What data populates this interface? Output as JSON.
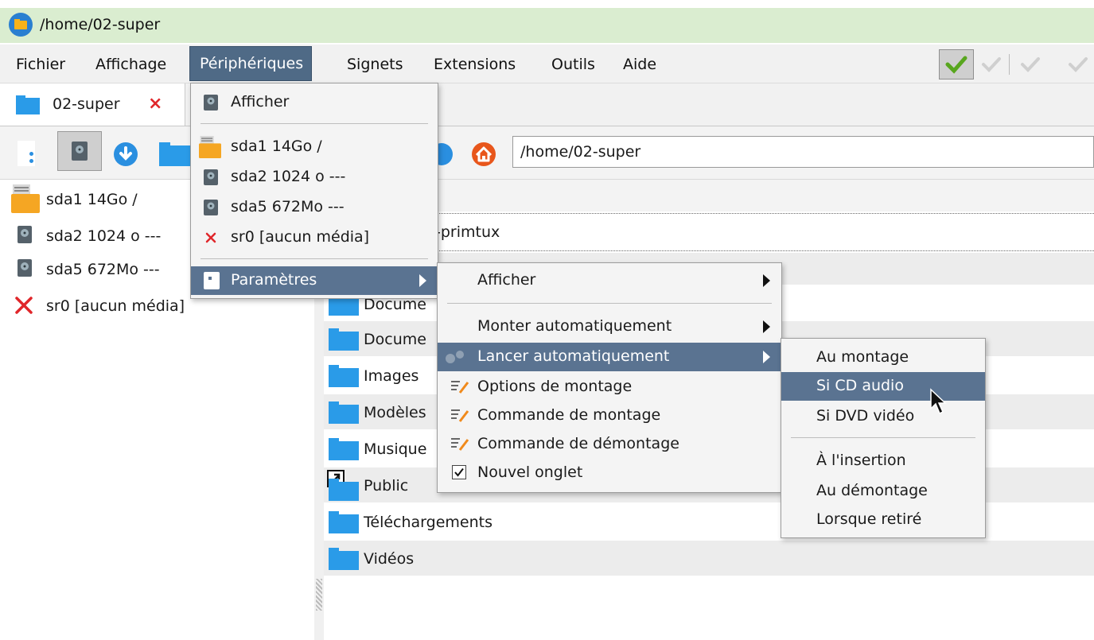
{
  "window": {
    "title": "/home/02-super"
  },
  "menubar": {
    "items": [
      {
        "label": "Fichier"
      },
      {
        "label": "Affichage"
      },
      {
        "label": "Périphériques"
      },
      {
        "label": "Signets"
      },
      {
        "label": "Extensions"
      },
      {
        "label": "Outils"
      },
      {
        "label": "Aide"
      }
    ]
  },
  "tabs": [
    {
      "label": "02-super"
    }
  ],
  "toolbar": {
    "address_value": "/home/02-super"
  },
  "devices": [
    {
      "label": "sda1 14Go /",
      "icon": "folder-drive-icon"
    },
    {
      "label": "sda2 1024 o ---",
      "icon": "disk-icon"
    },
    {
      "label": "sda5 672Mo ---",
      "icon": "disk-icon"
    },
    {
      "label": "sr0 [aucun média]",
      "icon": "no-media-icon"
    }
  ],
  "peripheriques_menu": {
    "show": "Afficher",
    "devices": [
      {
        "label": "sda1 14Go /"
      },
      {
        "label": "sda2 1024 o ---"
      },
      {
        "label": "sda5 672Mo ---"
      },
      {
        "label": "sr0 [aucun média]"
      }
    ],
    "parametres": "Paramètres"
  },
  "parametres_menu": {
    "afficher": "Afficher",
    "monter_auto": "Monter automatiquement",
    "lancer_auto": "Lancer automatiquement",
    "options_montage": "Options de montage",
    "commande_montage": "Commande de montage",
    "commande_demontage": "Commande de démontage",
    "nouvel_onglet": "Nouvel onglet"
  },
  "lancer_menu": {
    "au_montage": "Au montage",
    "si_cd_audio": "Si CD audio",
    "si_dvd_video": "Si DVD vidéo",
    "a_insertion": "À l'insertion",
    "au_demontage": "Au démontage",
    "lorsque_retire": "Lorsque retiré"
  },
  "files": {
    "path_fragment": "-primtux",
    "items": [
      {
        "label": "Docume"
      },
      {
        "label": "Docume"
      },
      {
        "label": "Images"
      },
      {
        "label": "Modèles"
      },
      {
        "label": "Musique"
      },
      {
        "label": "Public"
      },
      {
        "label": "Téléchargements"
      },
      {
        "label": "Vidéos"
      }
    ]
  },
  "colors": {
    "titlebar": "#daedd0",
    "menu_highlight": "#5a7391",
    "folder_blue": "#2a9be8"
  }
}
